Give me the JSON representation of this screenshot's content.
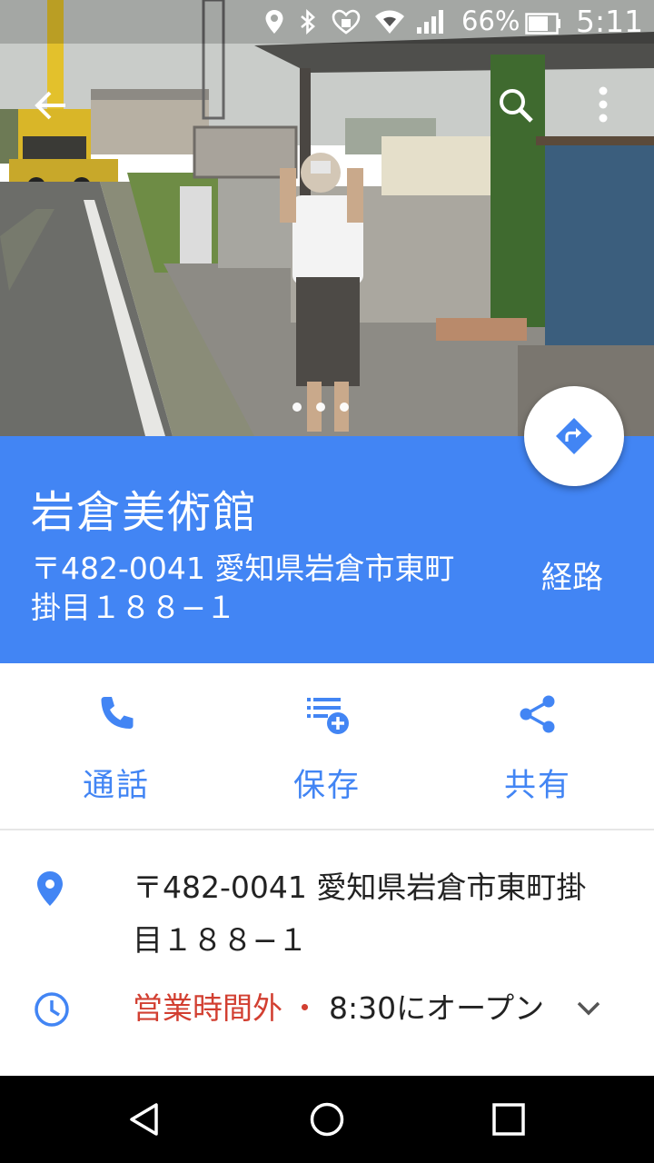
{
  "status_bar": {
    "icons": [
      "location-icon",
      "bluetooth-icon",
      "security-icon",
      "wifi-icon",
      "signal-icon",
      "battery-icon"
    ],
    "battery_percent": "66%",
    "time": "5:11"
  },
  "app_bar": {
    "back_icon": "back-arrow-icon",
    "search_icon": "search-icon",
    "more_icon": "more-vert-icon"
  },
  "photo": {
    "page_count": 3,
    "current_page": 1
  },
  "place": {
    "name": "岩倉美術館",
    "address_line1": "〒482-0041 愛知県岩倉市東町",
    "address_line2": "掛目１８８−１",
    "directions_label": "経路"
  },
  "actions": [
    {
      "icon": "phone-icon",
      "label": "通話"
    },
    {
      "icon": "save-list-icon",
      "label": "保存"
    },
    {
      "icon": "share-icon",
      "label": "共有"
    }
  ],
  "details": {
    "address_line1": "〒482-0041 愛知県岩倉市東町掛",
    "address_line2": "目１８８−１",
    "hours_status": "営業時間外",
    "hours_separator": "・",
    "hours_next": "8:30にオープン"
  },
  "colors": {
    "accent": "#4285f4",
    "closed": "#d23f31"
  }
}
